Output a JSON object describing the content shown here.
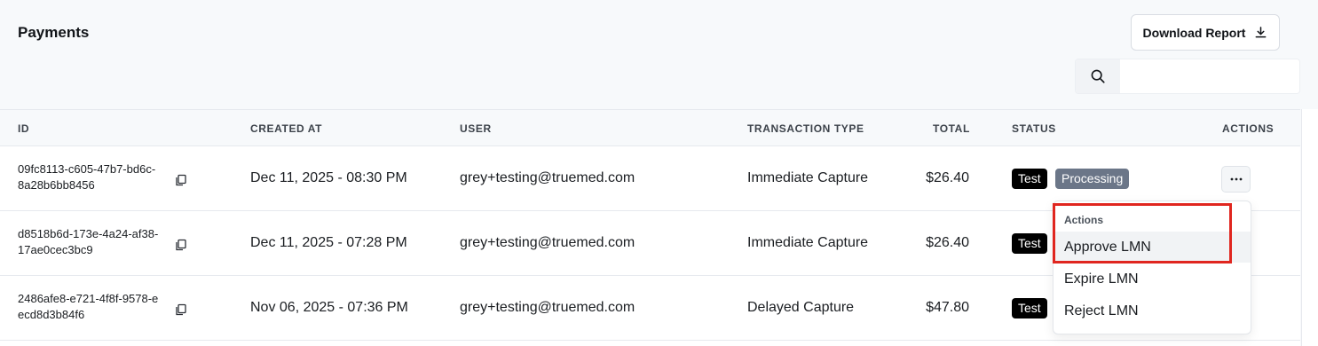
{
  "page": {
    "title": "Payments"
  },
  "toolbar": {
    "download_label": "Download Report"
  },
  "search": {
    "placeholder": "",
    "value": ""
  },
  "table": {
    "headers": {
      "id": "ID",
      "created_at": "CREATED AT",
      "user": "USER",
      "transaction_type": "TRANSACTION TYPE",
      "total": "TOTAL",
      "status": "STATUS",
      "actions": "ACTIONS"
    },
    "rows": [
      {
        "id": "09fc8113-c605-47b7-bd6c-8a28b6bb8456",
        "created_at": "Dec 11, 2025 - 08:30 PM",
        "user": "grey+testing@truemed.com",
        "transaction_type": "Immediate Capture",
        "total": "$26.40",
        "badges": [
          "Test",
          "Processing"
        ]
      },
      {
        "id": "d8518b6d-173e-4a24-af38-17ae0cec3bc9",
        "created_at": "Dec 11, 2025 - 07:28 PM",
        "user": "grey+testing@truemed.com",
        "transaction_type": "Immediate Capture",
        "total": "$26.40",
        "badges": [
          "Test"
        ]
      },
      {
        "id": "2486afe8-e721-4f8f-9578-eecd8d3b84f6",
        "created_at": "Nov 06, 2025 - 07:36 PM",
        "user": "grey+testing@truemed.com",
        "transaction_type": "Delayed Capture",
        "total": "$47.80",
        "badges": [
          "Test"
        ]
      }
    ]
  },
  "actions_menu": {
    "label": "Actions",
    "items": [
      "Approve LMN",
      "Expire LMN",
      "Reject LMN"
    ]
  },
  "icons": {
    "download": "download-icon",
    "search": "search-icon",
    "copy": "copy-icon",
    "more": "more-horizontal-icon"
  },
  "colors": {
    "badge_test": "#000000",
    "badge_processing": "#6b7688",
    "highlight": "#e0261f"
  }
}
